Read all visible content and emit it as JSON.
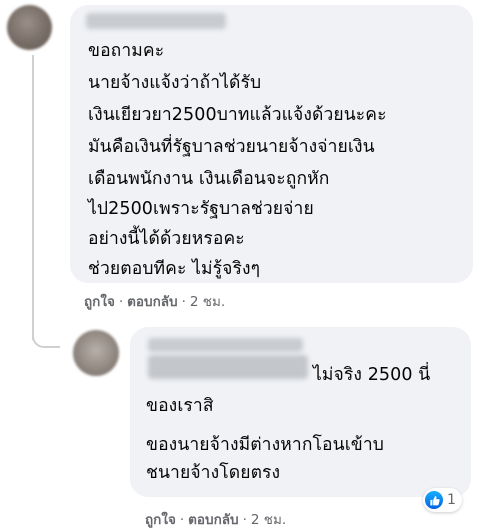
{
  "comment": {
    "lines": [
      "ขอถามคะ",
      "นายจ้างแจ้งว่าถ้าได้รับ",
      "เงินเยียวยา2500บาทแล้วแจ้งด้วยนะคะ",
      "มันคือเงินที่รัฐบาลช่วยนายจ้างจ่ายเงิน",
      "เดือนพนักงาน เงินเดือนจะถูกหัก",
      "ไป2500เพราะรัฐบาลช่วยจ่าย",
      "อย่างนี้ได้ด้วยหรอคะ",
      "ช่วยตอบทีคะ ไม่รู้จริงๆ"
    ],
    "like_label": "ถูกใจ",
    "reply_label": "ตอบกลับ",
    "timestamp": "2 ชม."
  },
  "reply": {
    "first_line_text": "ไม่จริง 2500 นี่",
    "lines": [
      "ของเราสิ",
      "ของนายจ้างมีต่างหากโอนเข้าบ",
      "ชนายจ้างโดยตรง"
    ],
    "reaction_count": "1",
    "like_label": "ถูกใจ",
    "reply_label": "ตอบกลับ",
    "timestamp": "2 ชม."
  },
  "separator": "·",
  "colors": {
    "bubble": "#f0f2f5",
    "meta_text": "#65676b",
    "like_blue": "#1877f2"
  }
}
